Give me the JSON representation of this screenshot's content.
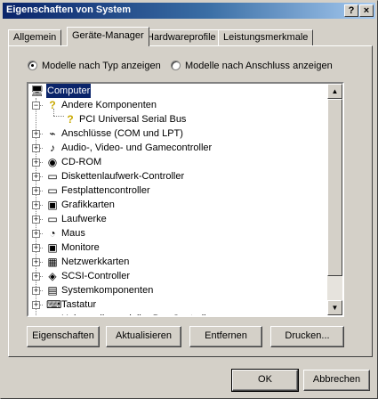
{
  "window": {
    "title": "Eigenschaften von System",
    "help_label": "?",
    "close_label": "×"
  },
  "tabs": [
    {
      "label": "Allgemein",
      "active": false
    },
    {
      "label": "Geräte-Manager",
      "active": true
    },
    {
      "label": "Hardwareprofile",
      "active": false
    },
    {
      "label": "Leistungsmerkmale",
      "active": false
    }
  ],
  "view_mode": {
    "by_type": {
      "label": "Modelle nach Typ anzeigen",
      "selected": true
    },
    "by_connection": {
      "label": "Modelle nach Anschluss anzeigen",
      "selected": false
    }
  },
  "tree": {
    "root": "Computer",
    "nodes": [
      {
        "label": "Andere Komponenten",
        "icon": "question-icon",
        "expanded": true
      },
      {
        "label": "PCI Universal Serial Bus",
        "icon": "question-icon",
        "child": true
      },
      {
        "label": "Anschlüsse (COM und LPT)",
        "icon": "port-icon"
      },
      {
        "label": "Audio-, Video- und Gamecontroller",
        "icon": "speaker-icon"
      },
      {
        "label": "CD-ROM",
        "icon": "cdrom-icon"
      },
      {
        "label": "Diskettenlaufwerk-Controller",
        "icon": "floppy-controller-icon"
      },
      {
        "label": "Festplattencontroller",
        "icon": "disk-controller-icon"
      },
      {
        "label": "Grafikkarten",
        "icon": "monitor-icon"
      },
      {
        "label": "Laufwerke",
        "icon": "drive-icon"
      },
      {
        "label": "Maus",
        "icon": "mouse-icon"
      },
      {
        "label": "Monitore",
        "icon": "monitor-icon"
      },
      {
        "label": "Netzwerkkarten",
        "icon": "network-card-icon"
      },
      {
        "label": "SCSI-Controller",
        "icon": "scsi-icon"
      },
      {
        "label": "Systemkomponenten",
        "icon": "computer-icon"
      },
      {
        "label": "Tastatur",
        "icon": "keyboard-icon"
      },
      {
        "label": "Universeller serieller Bus Controller",
        "icon": "usb-icon"
      }
    ]
  },
  "buttons": {
    "properties": "Eigenschaften",
    "refresh": "Aktualisieren",
    "remove": "Entfernen",
    "print": "Drucken...",
    "ok": "OK",
    "cancel": "Abbrechen"
  },
  "colors": {
    "selection": "#0a246a",
    "titlebar": "#0a246a",
    "face": "#d4d0c8"
  }
}
